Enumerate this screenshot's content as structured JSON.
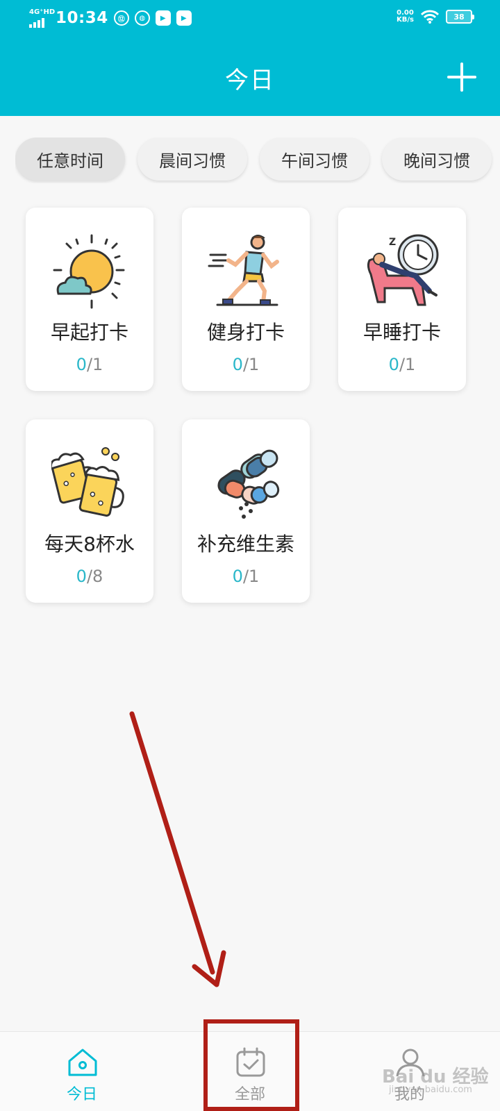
{
  "status_bar": {
    "network": "4G⁺HD",
    "time": "10:34",
    "speed_value": "0.00",
    "speed_unit": "KB/s",
    "battery": "38"
  },
  "header": {
    "title": "今日",
    "add_icon": "plus-icon",
    "background_color": "#00bcd4"
  },
  "filters": [
    {
      "label": "任意时间",
      "active": true
    },
    {
      "label": "晨间习惯",
      "active": false
    },
    {
      "label": "午间习惯",
      "active": false
    },
    {
      "label": "晚间习惯",
      "active": false
    }
  ],
  "habits": [
    {
      "name": "早起打卡",
      "done": "0",
      "total": "/1",
      "icon": "sun-cloud-icon"
    },
    {
      "name": "健身打卡",
      "done": "0",
      "total": "/1",
      "icon": "runner-icon"
    },
    {
      "name": "早睡打卡",
      "done": "0",
      "total": "/1",
      "icon": "sleep-clock-icon"
    },
    {
      "name": "每天8杯水",
      "done": "0",
      "total": "/8",
      "icon": "beer-mugs-icon"
    },
    {
      "name": "补充维生素",
      "done": "0",
      "total": "/1",
      "icon": "vitamin-pills-icon"
    }
  ],
  "bottom_nav": [
    {
      "label": "今日",
      "icon": "home-icon",
      "active": true
    },
    {
      "label": "全部",
      "icon": "calendar-check-icon",
      "active": false
    },
    {
      "label": "我的",
      "icon": "user-icon",
      "active": false
    }
  ],
  "overlay": {
    "watermark": "Bai du 经验",
    "watermark_sub": "jingyan.baidu.com",
    "annotation_color": "#b01f17"
  }
}
